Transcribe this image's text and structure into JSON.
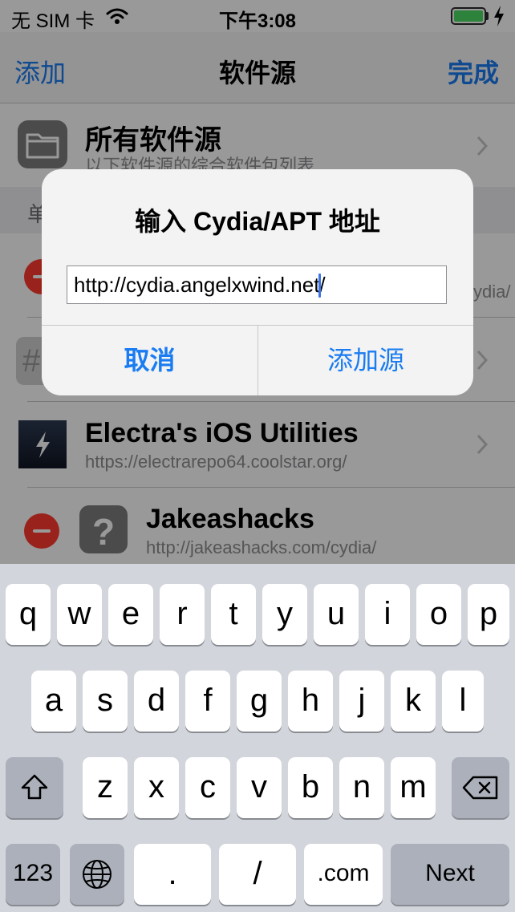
{
  "status_bar": {
    "carrier": "无 SIM 卡",
    "time": "下午3:08"
  },
  "nav": {
    "left_button": "添加",
    "title": "软件源",
    "right_button": "完成"
  },
  "list": {
    "all_sources": {
      "title": "所有软件源",
      "subtitle": "以下软件源的综合软件包列表"
    },
    "section_letter": "单",
    "partial_right_text": "ydia/",
    "partial_left_text": "#",
    "sources": [
      {
        "title": "Electra's iOS Utilities",
        "url": "https://electrarepo64.coolstar.org/",
        "icon": "bolt-icon"
      },
      {
        "title": "Jakeashacks",
        "url": "http://jakeashacks.com/cydia/",
        "icon": "question-mark-icon",
        "icon_text": "?"
      }
    ]
  },
  "alert": {
    "title": "输入 Cydia/APT 地址",
    "input_value": "http://cydia.angelxwind.net/",
    "cancel": "取消",
    "confirm": "添加源"
  },
  "keyboard": {
    "row1": [
      "q",
      "w",
      "e",
      "r",
      "t",
      "y",
      "u",
      "i",
      "o",
      "p"
    ],
    "row2": [
      "a",
      "s",
      "d",
      "f",
      "g",
      "h",
      "j",
      "k",
      "l"
    ],
    "row3": [
      "z",
      "x",
      "c",
      "v",
      "b",
      "n",
      "m"
    ],
    "row4": {
      "numbers": "123",
      "period": ".",
      "slash": "/",
      "dotcom": ".com",
      "next": "Next"
    }
  },
  "colors": {
    "accent": "#1a7cf2",
    "delete": "#ff3b30",
    "battery": "#4cd964"
  }
}
